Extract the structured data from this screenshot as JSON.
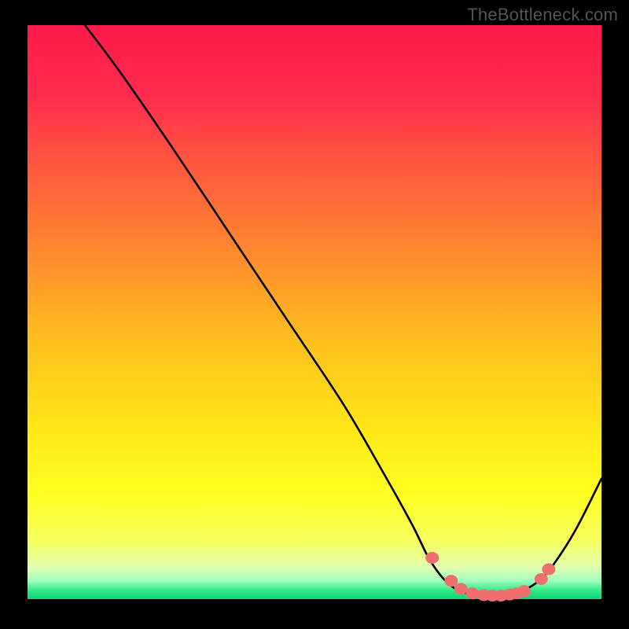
{
  "watermark": "TheBottleneck.com",
  "chart_data": {
    "type": "line",
    "title": "",
    "xlabel": "",
    "ylabel": "",
    "xlim": [
      0,
      100
    ],
    "ylim": [
      0,
      100
    ],
    "gradient_stops": [
      {
        "pos": 0.0,
        "color": "#ff1a4a"
      },
      {
        "pos": 0.12,
        "color": "#ff2b4e"
      },
      {
        "pos": 0.25,
        "color": "#ff5a3e"
      },
      {
        "pos": 0.4,
        "color": "#ff8a2e"
      },
      {
        "pos": 0.55,
        "color": "#ffbf1e"
      },
      {
        "pos": 0.7,
        "color": "#ffe617"
      },
      {
        "pos": 0.82,
        "color": "#ffff20"
      },
      {
        "pos": 0.9,
        "color": "#f5ff60"
      },
      {
        "pos": 0.945,
        "color": "#e0ffb0"
      },
      {
        "pos": 0.968,
        "color": "#a0ffc0"
      },
      {
        "pos": 0.985,
        "color": "#30e886"
      },
      {
        "pos": 1.0,
        "color": "#10d278"
      }
    ],
    "curve_points": [
      {
        "x": 10,
        "y": 100
      },
      {
        "x": 16,
        "y": 92
      },
      {
        "x": 25,
        "y": 79
      },
      {
        "x": 35,
        "y": 64
      },
      {
        "x": 45,
        "y": 49
      },
      {
        "x": 55,
        "y": 34
      },
      {
        "x": 62,
        "y": 22
      },
      {
        "x": 67,
        "y": 13
      },
      {
        "x": 70,
        "y": 7
      },
      {
        "x": 73,
        "y": 3
      },
      {
        "x": 76,
        "y": 1.2
      },
      {
        "x": 80,
        "y": 0.6
      },
      {
        "x": 84,
        "y": 0.8
      },
      {
        "x": 87,
        "y": 1.8
      },
      {
        "x": 90,
        "y": 4
      },
      {
        "x": 93,
        "y": 8
      },
      {
        "x": 96,
        "y": 13
      },
      {
        "x": 100,
        "y": 21
      }
    ],
    "dots": [
      {
        "x": 70.5,
        "y": 7.2
      },
      {
        "x": 73.8,
        "y": 3.2
      },
      {
        "x": 75.5,
        "y": 1.8
      },
      {
        "x": 77.5,
        "y": 1.0
      },
      {
        "x": 79.5,
        "y": 0.7
      },
      {
        "x": 81.0,
        "y": 0.6
      },
      {
        "x": 82.5,
        "y": 0.6
      },
      {
        "x": 84.0,
        "y": 0.8
      },
      {
        "x": 85.2,
        "y": 1.0
      },
      {
        "x": 86.5,
        "y": 1.4
      },
      {
        "x": 89.5,
        "y": 3.5
      },
      {
        "x": 90.8,
        "y": 5.2
      }
    ],
    "dot_color": "#ef6e6e",
    "curve_color": "#000000"
  }
}
